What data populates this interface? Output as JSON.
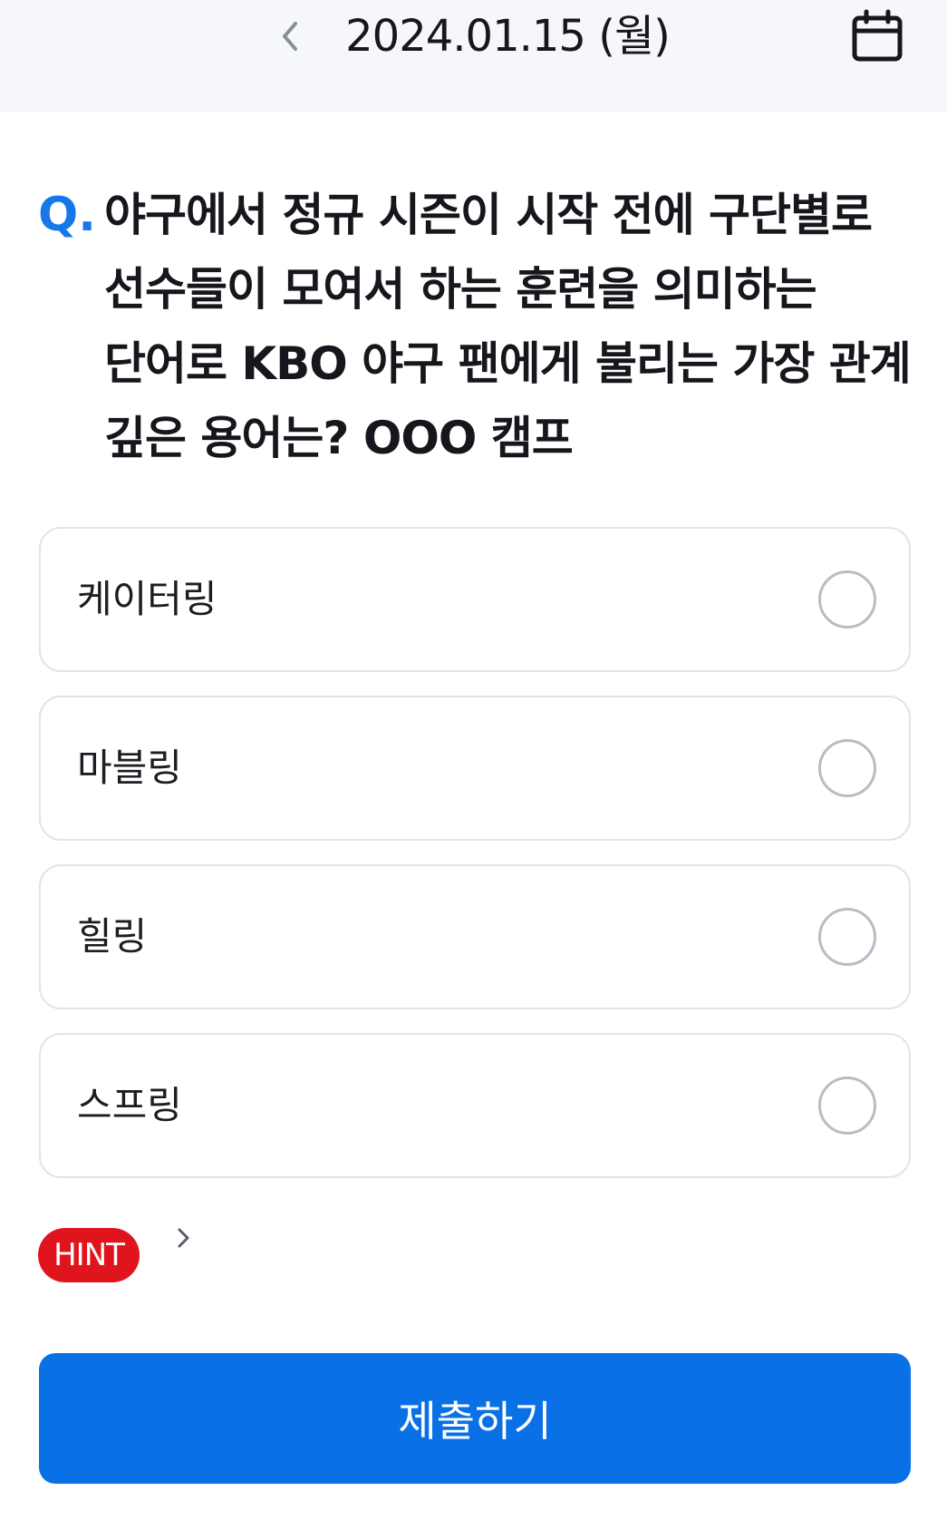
{
  "header": {
    "date": "2024.01.15 (월)",
    "back_icon": "chevron-left-icon",
    "calendar_icon": "calendar-icon"
  },
  "question": {
    "prefix": "Q.",
    "text": "야구에서 정규 시즌이 시작 전에 구단별로 선수들이 모여서 하는 훈련을 의미하는 단어로 KBO 야구 팬에게 불리는 가장 관계 깊은 용어는? OOO 캠프"
  },
  "options": [
    {
      "label": "케이터링",
      "selected": false
    },
    {
      "label": "마블링",
      "selected": false
    },
    {
      "label": "힐링",
      "selected": false
    },
    {
      "label": "스프링",
      "selected": false
    }
  ],
  "hint": {
    "label": "HINT",
    "icon": "chevron-right-icon"
  },
  "submit": {
    "label": "제출하기"
  },
  "colors": {
    "accent": "#0a70e6",
    "hint": "#e0141c",
    "header_bg": "#f5f7fb"
  }
}
